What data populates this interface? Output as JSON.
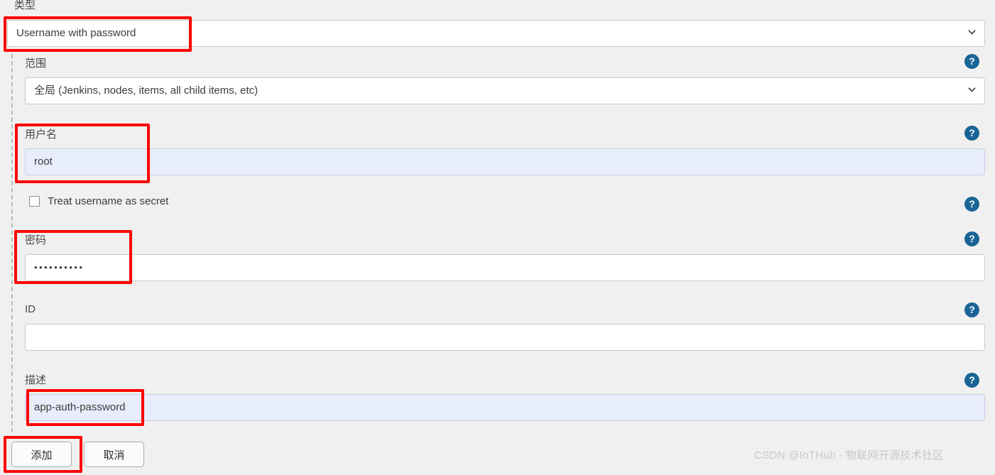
{
  "form": {
    "type": {
      "label": "类型",
      "value": "Username with password",
      "icon": "chevron-down-icon"
    },
    "scope": {
      "label": "范围",
      "value": "全局 (Jenkins, nodes, items, all child items, etc)",
      "icon": "chevron-down-icon",
      "help": "?"
    },
    "username": {
      "label": "用户名",
      "value": "root",
      "help": "?"
    },
    "treat_username_as_secret": {
      "label": "Treat username as secret",
      "checked": false,
      "help": "?"
    },
    "password": {
      "label": "密码",
      "value": "••••••••••",
      "help": "?"
    },
    "id": {
      "label": "ID",
      "value": "",
      "placeholder": "",
      "help": "?"
    },
    "description": {
      "label": "描述",
      "value": "app-auth-password",
      "help": "?"
    }
  },
  "actions": {
    "submit_label": "添加",
    "cancel_label": "取消"
  },
  "watermark": {
    "text": "CSDN @IoTHub - 物联网开源技术社区"
  },
  "colors": {
    "background": "#f0f0f0",
    "help_icon": "#1a6496",
    "annotation": "#fb0606",
    "autofill_field": "#e8edfb",
    "field_border": "#c9c9c9"
  }
}
